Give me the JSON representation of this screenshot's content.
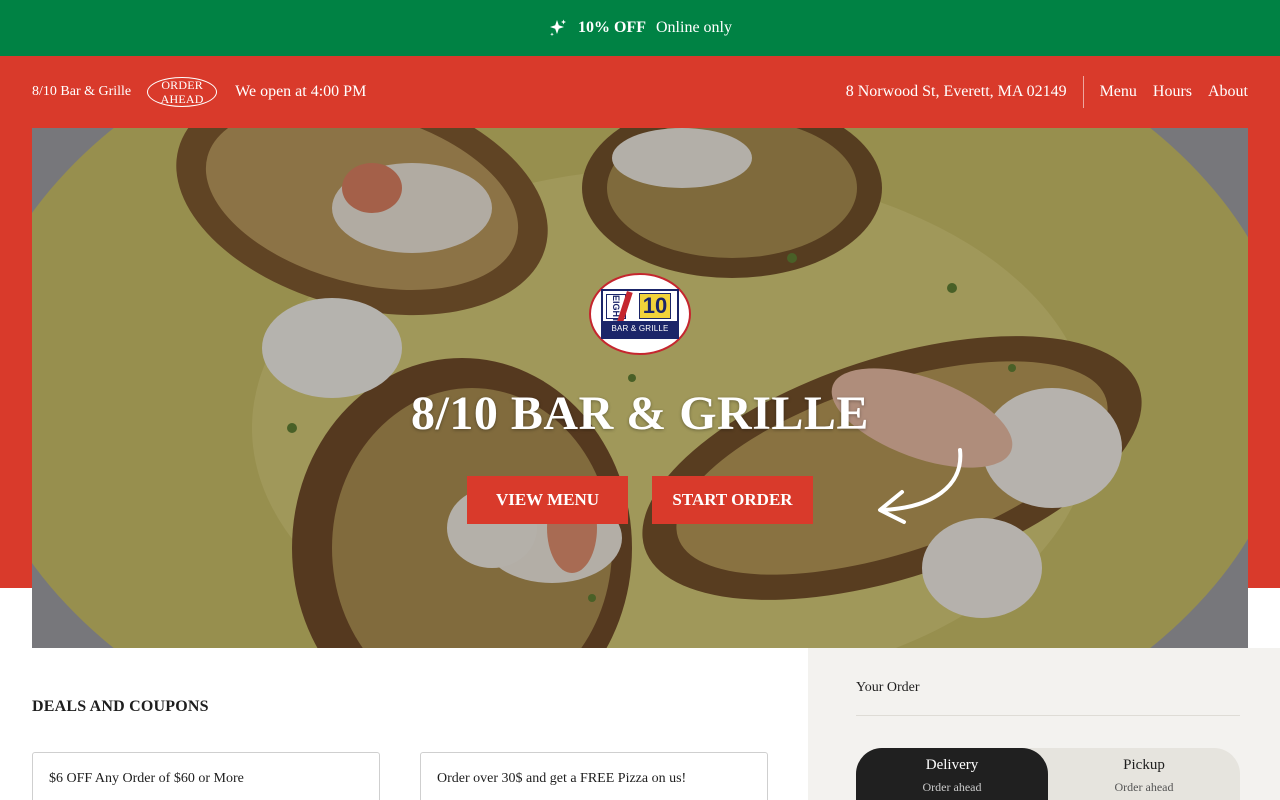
{
  "promo": {
    "icon": "sparkle-icon",
    "discount": "10% OFF",
    "note": "Online only"
  },
  "header": {
    "brand": "8/10 Bar & Grille",
    "badge_line1": "ORDER",
    "badge_line2": "AHEAD",
    "open_status": "We open at 4:00 PM",
    "address": "8 Norwood St, Everett, MA 02149",
    "nav": [
      "Menu",
      "Hours",
      "About"
    ]
  },
  "hero": {
    "logo": {
      "eight": "EIGHT",
      "ten": "10",
      "caption": "BAR & GRILLE"
    },
    "title": "8/10 BAR & GRILLE",
    "view_menu": "VIEW MENU",
    "start_order": "START ORDER",
    "arrow_icon": "curved-arrow-icon"
  },
  "deals": {
    "heading": "DEALS AND COUPONS",
    "items": [
      "$6 OFF Any Order of $60 or More",
      "Order over 30$ and get a FREE Pizza on us!"
    ]
  },
  "cart": {
    "title": "Your Order",
    "modes": [
      {
        "label": "Delivery",
        "sub": "Order ahead"
      },
      {
        "label": "Pickup",
        "sub": "Order ahead"
      }
    ]
  },
  "colors": {
    "promo_green": "#008244",
    "brand_red": "#d93a2b",
    "dark": "#202020",
    "panel": "#f3f2ef"
  }
}
